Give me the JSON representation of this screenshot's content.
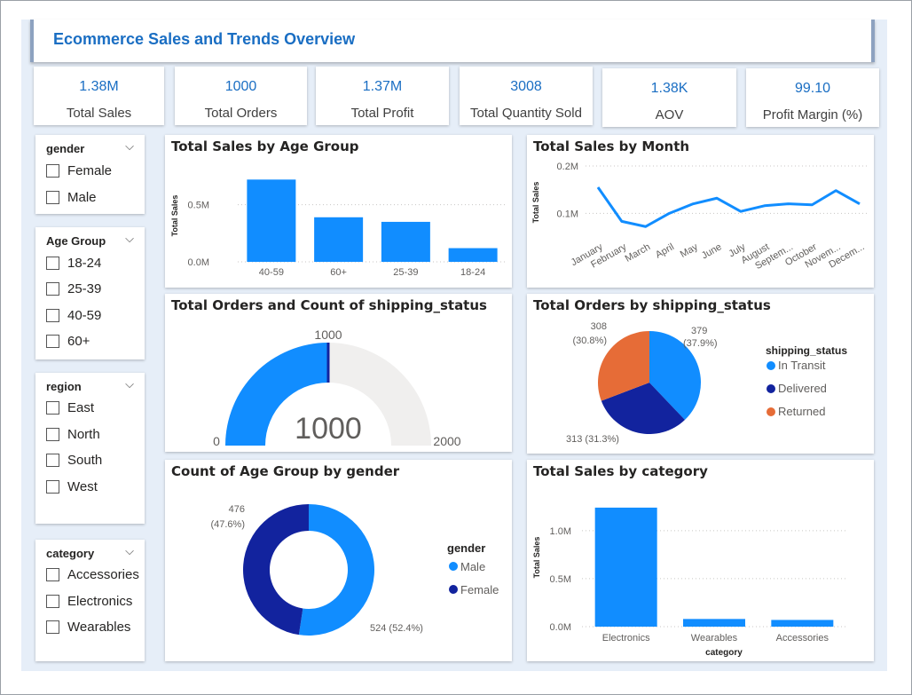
{
  "title": "Ecommerce Sales and Trends Overview",
  "kpis": [
    {
      "value": "1.38M",
      "label": "Total Sales"
    },
    {
      "value": "1000",
      "label": "Total Orders"
    },
    {
      "value": "1.37M",
      "label": "Total Profit"
    },
    {
      "value": "3008",
      "label": "Total Quantity Sold"
    },
    {
      "value": "1.38K",
      "label": "AOV"
    },
    {
      "value": "99.10",
      "label": "Profit Margin (%)"
    }
  ],
  "slicers": {
    "gender": {
      "label": "gender",
      "options": [
        "Female",
        "Male"
      ]
    },
    "age_group": {
      "label": "Age Group",
      "options": [
        "18-24",
        "25-39",
        "40-59",
        "60+"
      ]
    },
    "region": {
      "label": "region",
      "options": [
        "East",
        "North",
        "South",
        "West"
      ]
    },
    "category": {
      "label": "category",
      "options": [
        "Accessories",
        "Electronics",
        "Wearables"
      ]
    }
  },
  "chevron": "⌵",
  "colors": {
    "primary": "#118dff",
    "dark": "#12239e",
    "orange": "#e66c37",
    "gauge_bg": "#f0efee",
    "title": "#1a6ec3"
  },
  "chart_data": [
    {
      "type": "bar",
      "title": "Total Sales by Age Group",
      "ylabel": "Total Sales",
      "categories": [
        "40-59",
        "60+",
        "25-39",
        "18-24"
      ],
      "values": [
        0.72,
        0.39,
        0.35,
        0.12
      ],
      "value_unit": "M",
      "ylim": [
        0,
        0.8
      ],
      "yticks": [
        {
          "v": 0,
          "label": "0.0M"
        },
        {
          "v": 0.5,
          "label": "0.5M"
        }
      ]
    },
    {
      "type": "line",
      "title": "Total Sales by Month",
      "ylabel": "Total Sales",
      "x": [
        "January",
        "February",
        "March",
        "April",
        "May",
        "June",
        "July",
        "August",
        "Septem...",
        "October",
        "Novem...",
        "Decem..."
      ],
      "values": [
        0.155,
        0.083,
        0.072,
        0.1,
        0.12,
        0.132,
        0.104,
        0.116,
        0.12,
        0.118,
        0.148,
        0.12
      ],
      "value_unit": "M",
      "ylim": [
        0.05,
        0.2
      ],
      "yticks": [
        {
          "v": 0.1,
          "label": "0.1M"
        },
        {
          "v": 0.2,
          "label": "0.2M"
        }
      ]
    },
    {
      "type": "gauge",
      "title": "Total Orders and Count of shipping_status",
      "value": 1000,
      "target": 1000,
      "min": 0,
      "max": 2000,
      "value_label": "1000",
      "target_label": "1000",
      "min_label": "0",
      "max_label": "2000"
    },
    {
      "type": "pie",
      "title": "Total Orders by shipping_status",
      "legend_title": "shipping_status",
      "slices": [
        {
          "name": "In Transit",
          "value": 379,
          "label": "379",
          "pct": "(37.9%)"
        },
        {
          "name": "Delivered",
          "value": 313,
          "label": "313 (31.3%)"
        },
        {
          "name": "Returned",
          "value": 308,
          "label": "308",
          "pct": "(30.8%)"
        }
      ]
    },
    {
      "type": "pie",
      "title": "Count of Age Group by gender",
      "legend_title": "gender",
      "slices": [
        {
          "name": "Male",
          "value": 524,
          "label": "524 (52.4%)"
        },
        {
          "name": "Female",
          "value": 476,
          "label": "476",
          "pct": "(47.6%)"
        }
      ]
    },
    {
      "type": "bar",
      "title": "Total Sales by category",
      "xlabel": "category",
      "ylabel": "Total Sales",
      "categories": [
        "Electronics",
        "Wearables",
        "Accessories"
      ],
      "values": [
        1.24,
        0.08,
        0.07
      ],
      "value_unit": "M",
      "ylim": [
        0,
        1.35
      ],
      "yticks": [
        {
          "v": 0,
          "label": "0.0M"
        },
        {
          "v": 0.5,
          "label": "0.5M"
        },
        {
          "v": 1.0,
          "label": "1.0M"
        }
      ]
    }
  ]
}
